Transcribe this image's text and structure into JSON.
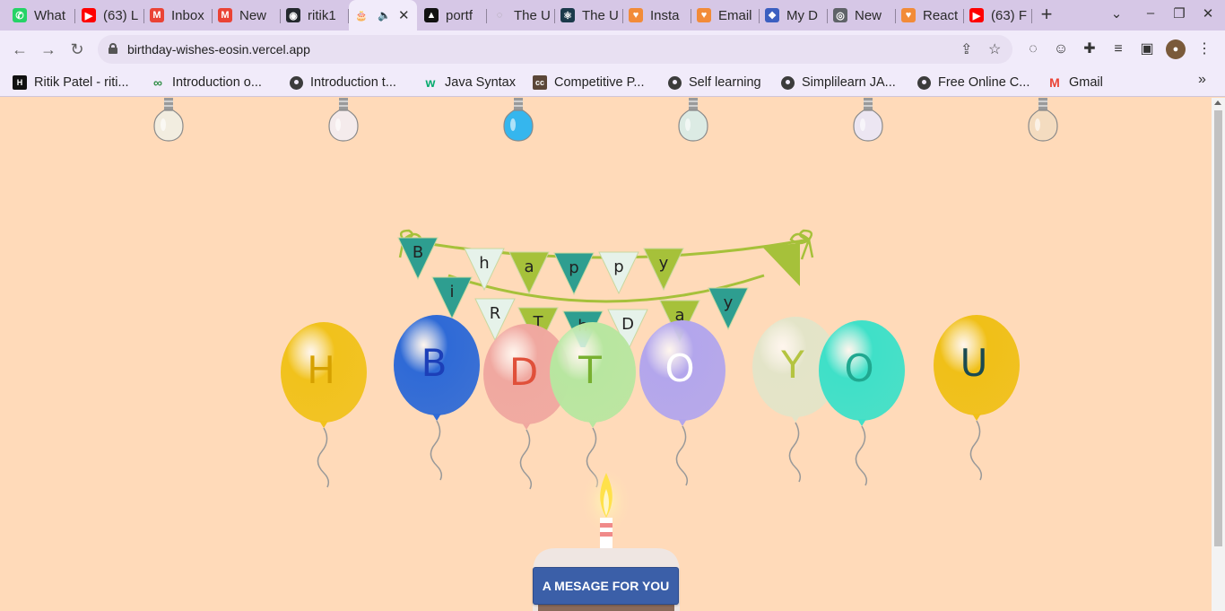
{
  "browser": {
    "tabs": [
      {
        "title": "What",
        "icon": "whatsapp-icon",
        "color": "#25d366",
        "glyph": "✆"
      },
      {
        "title": "(63) L",
        "icon": "youtube-icon",
        "color": "#ff0000",
        "glyph": "▶"
      },
      {
        "title": "Inbox",
        "icon": "gmail-icon",
        "color": "#ea4335",
        "glyph": "M"
      },
      {
        "title": "New",
        "icon": "gmail-icon",
        "color": "#ea4335",
        "glyph": "M"
      },
      {
        "title": "ritik1",
        "icon": "github-icon",
        "color": "#24292e",
        "glyph": "◉"
      },
      {
        "title": "",
        "icon": "cake-icon",
        "color": "#c0602a",
        "glyph": "🎂",
        "active": true
      },
      {
        "title": "portf",
        "icon": "vercel-icon",
        "color": "#111111",
        "glyph": "▲"
      },
      {
        "title": "The U",
        "icon": "loading-icon",
        "color": "#9e9e9e",
        "glyph": "◌"
      },
      {
        "title": "The U",
        "icon": "react-icon",
        "color": "#1b3a4b",
        "glyph": "⚛"
      },
      {
        "title": "Insta",
        "icon": "heart-icon",
        "color": "#f28b38",
        "glyph": "♥"
      },
      {
        "title": "Email",
        "icon": "heart-icon",
        "color": "#f28b38",
        "glyph": "♥"
      },
      {
        "title": "My D",
        "icon": "bookmark-icon",
        "color": "#3b5fc0",
        "glyph": "❖"
      },
      {
        "title": "New",
        "icon": "chrome-icon",
        "color": "#5f6368",
        "glyph": "◎"
      },
      {
        "title": "React",
        "icon": "heart-icon",
        "color": "#f28b38",
        "glyph": "♥"
      },
      {
        "title": "(63) F",
        "icon": "youtube-icon",
        "color": "#ff0000",
        "glyph": "▶"
      }
    ],
    "url": "birthday-wishes-eosin.vercel.app",
    "bookmarks": [
      {
        "label": "Ritik Patel - riti...",
        "icon": "hackerrank-icon",
        "color": "#111111",
        "glyph": "H"
      },
      {
        "label": "Introduction o...",
        "icon": "gfg-icon",
        "color": "#2f8d46",
        "glyph": "∞"
      },
      {
        "label": "Introduction t...",
        "icon": "globe-icon"
      },
      {
        "label": "Java Syntax",
        "icon": "w3schools-icon",
        "color": "#04aa6d",
        "glyph": "w"
      },
      {
        "label": "Competitive P...",
        "icon": "codechef-icon",
        "color": "#5b4638",
        "glyph": "cc"
      },
      {
        "label": "Self learning",
        "icon": "globe-icon"
      },
      {
        "label": "Simplilearn JA...",
        "icon": "globe-icon"
      },
      {
        "label": "Free Online C...",
        "icon": "globe-icon"
      },
      {
        "label": "Gmail",
        "icon": "gmail-icon",
        "color": "#ea4335",
        "glyph": "M"
      }
    ]
  },
  "page": {
    "bulbs": [
      {
        "color": "#f2ede0"
      },
      {
        "color": "#f4ebec"
      },
      {
        "color": "#35b6ee"
      },
      {
        "color": "#dcebe4"
      },
      {
        "color": "#ece6f2"
      },
      {
        "color": "#f4dcc0"
      }
    ],
    "banner_letters": [
      "B",
      "h",
      "a",
      "p",
      "p",
      "y",
      "i",
      "R",
      "T",
      "h",
      "D",
      "a",
      "y"
    ],
    "balloons": [
      {
        "letter": "H",
        "color": "#f1c21c",
        "text_color": "#d6a100"
      },
      {
        "letter": "B",
        "color": "#2f6ad6",
        "text_color": "#1c3fb8"
      },
      {
        "letter": "D",
        "color": "#f0a8a0",
        "text_color": "#e0503a"
      },
      {
        "letter": "T",
        "color": "#b8e6a0",
        "text_color": "#78b030"
      },
      {
        "letter": "O",
        "color": "#b3a6ec",
        "text_color": "#ffffff"
      },
      {
        "letter": "Y",
        "color": "#e3e4c8",
        "text_color": "#b4c440"
      },
      {
        "letter": "O",
        "color": "#3fe0c8",
        "text_color": "#20a890"
      },
      {
        "letter": "U",
        "color": "#f0c018",
        "text_color": "#1a4a50"
      }
    ],
    "message_button": "A MESAGE FOR YOU"
  }
}
